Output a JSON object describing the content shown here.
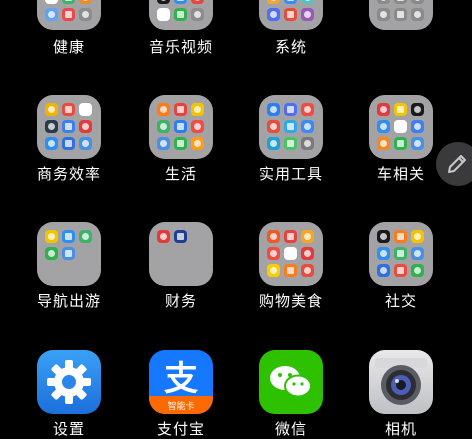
{
  "folders": [
    {
      "label": "健康",
      "tiles": [
        "#3a6fd8",
        "#e23b3b",
        "#46a0f0",
        "#ffffff",
        "#3fb26a",
        "#f08a24",
        "#5fa3f2",
        "#e84a4a",
        "#8c8c8c"
      ]
    },
    {
      "label": "音乐视频",
      "tiles": [
        "#e7334a",
        "#4a5bd8",
        "#f5c400",
        "#1a1a1a",
        "#2f8ff0",
        "#e8453c",
        "#ffffff",
        "#2fb24d",
        "#8c8c8c"
      ]
    },
    {
      "label": "系统",
      "tiles": [
        "#2a7ff5",
        "#ef4d43",
        "#4cc266",
        "#f0a63a",
        "#3d8af7",
        "#59c3c3",
        "#4f6ef2",
        "#e74c3c",
        "#9b59b6"
      ]
    },
    {
      "label": "",
      "tiles": [
        "#8a8a8a",
        "#8a8a8a",
        "#8a8a8a",
        "#8a8a8a",
        "#8a8a8a",
        "#8a8a8a",
        "#8a8a8a",
        "#8a8a8a",
        "#8a8a8a"
      ]
    },
    {
      "label": "商务效率",
      "tiles": [
        "#f0b400",
        "#e74c3c",
        "#ffffff",
        "#2d3a4a",
        "#3d7ff2",
        "#e23b3b",
        "#2f8ff0",
        "#2f6fe0",
        "#4a90e2"
      ]
    },
    {
      "label": "生活",
      "tiles": [
        "#ff7a1a",
        "#e8423c",
        "#f5c400",
        "#3fb26a",
        "#2b7ff0",
        "#ef4d43",
        "#4a90e2",
        "#2fb24d",
        "#ff9a1a"
      ]
    },
    {
      "label": "实用工具",
      "tiles": [
        "#2a7ff5",
        "#4f6ef2",
        "#ef4d43",
        "#e74c3c",
        "#2fa8f0",
        "#3d8af7",
        "#1f9fd6",
        "#4cc266",
        "#7a7a7a"
      ]
    },
    {
      "label": "车相关",
      "tiles": [
        "#e23b3b",
        "#f5c400",
        "#1a1a1a",
        "#2f8ff0",
        "#ffffff",
        "#3d7ff2",
        "#f08a24",
        "#2fb24d",
        "#4a90e2"
      ]
    },
    {
      "label": "导航出游",
      "tiles": [
        "#f5c400",
        "#2f8ff0",
        "#3fb26a",
        "#2fb24d",
        "#4a90e2",
        "#a3a3a5",
        "#a3a3a5",
        "#a3a3a5",
        "#a3a3a5"
      ]
    },
    {
      "label": "财务",
      "tiles": [
        "#e23b3b",
        "#1f3f8f",
        "#a3a3a5",
        "#a3a3a5",
        "#a3a3a5",
        "#a3a3a5",
        "#a3a3a5",
        "#a3a3a5",
        "#a3a3a5"
      ]
    },
    {
      "label": "购物美食",
      "tiles": [
        "#f05a28",
        "#e8423c",
        "#f5a623",
        "#ef4d43",
        "#ffffff",
        "#e23b3b",
        "#ffcc00",
        "#ff7a1a",
        "#e74c3c"
      ]
    },
    {
      "label": "社交",
      "tiles": [
        "#1a1a1a",
        "#ff7a1a",
        "#f5c400",
        "#2f8ff0",
        "#3fb26a",
        "#4a90e2",
        "#2f6fe0",
        "#e74c3c",
        "#2fb24d"
      ]
    }
  ],
  "apps": [
    {
      "label": "设置",
      "icon": "settings-gear-icon"
    },
    {
      "label": "支付宝",
      "icon": "alipay-icon",
      "badge": "智能卡"
    },
    {
      "label": "微信",
      "icon": "wechat-icon"
    },
    {
      "label": "相机",
      "icon": "camera-icon"
    }
  ],
  "edit_icon": "pencil-icon"
}
